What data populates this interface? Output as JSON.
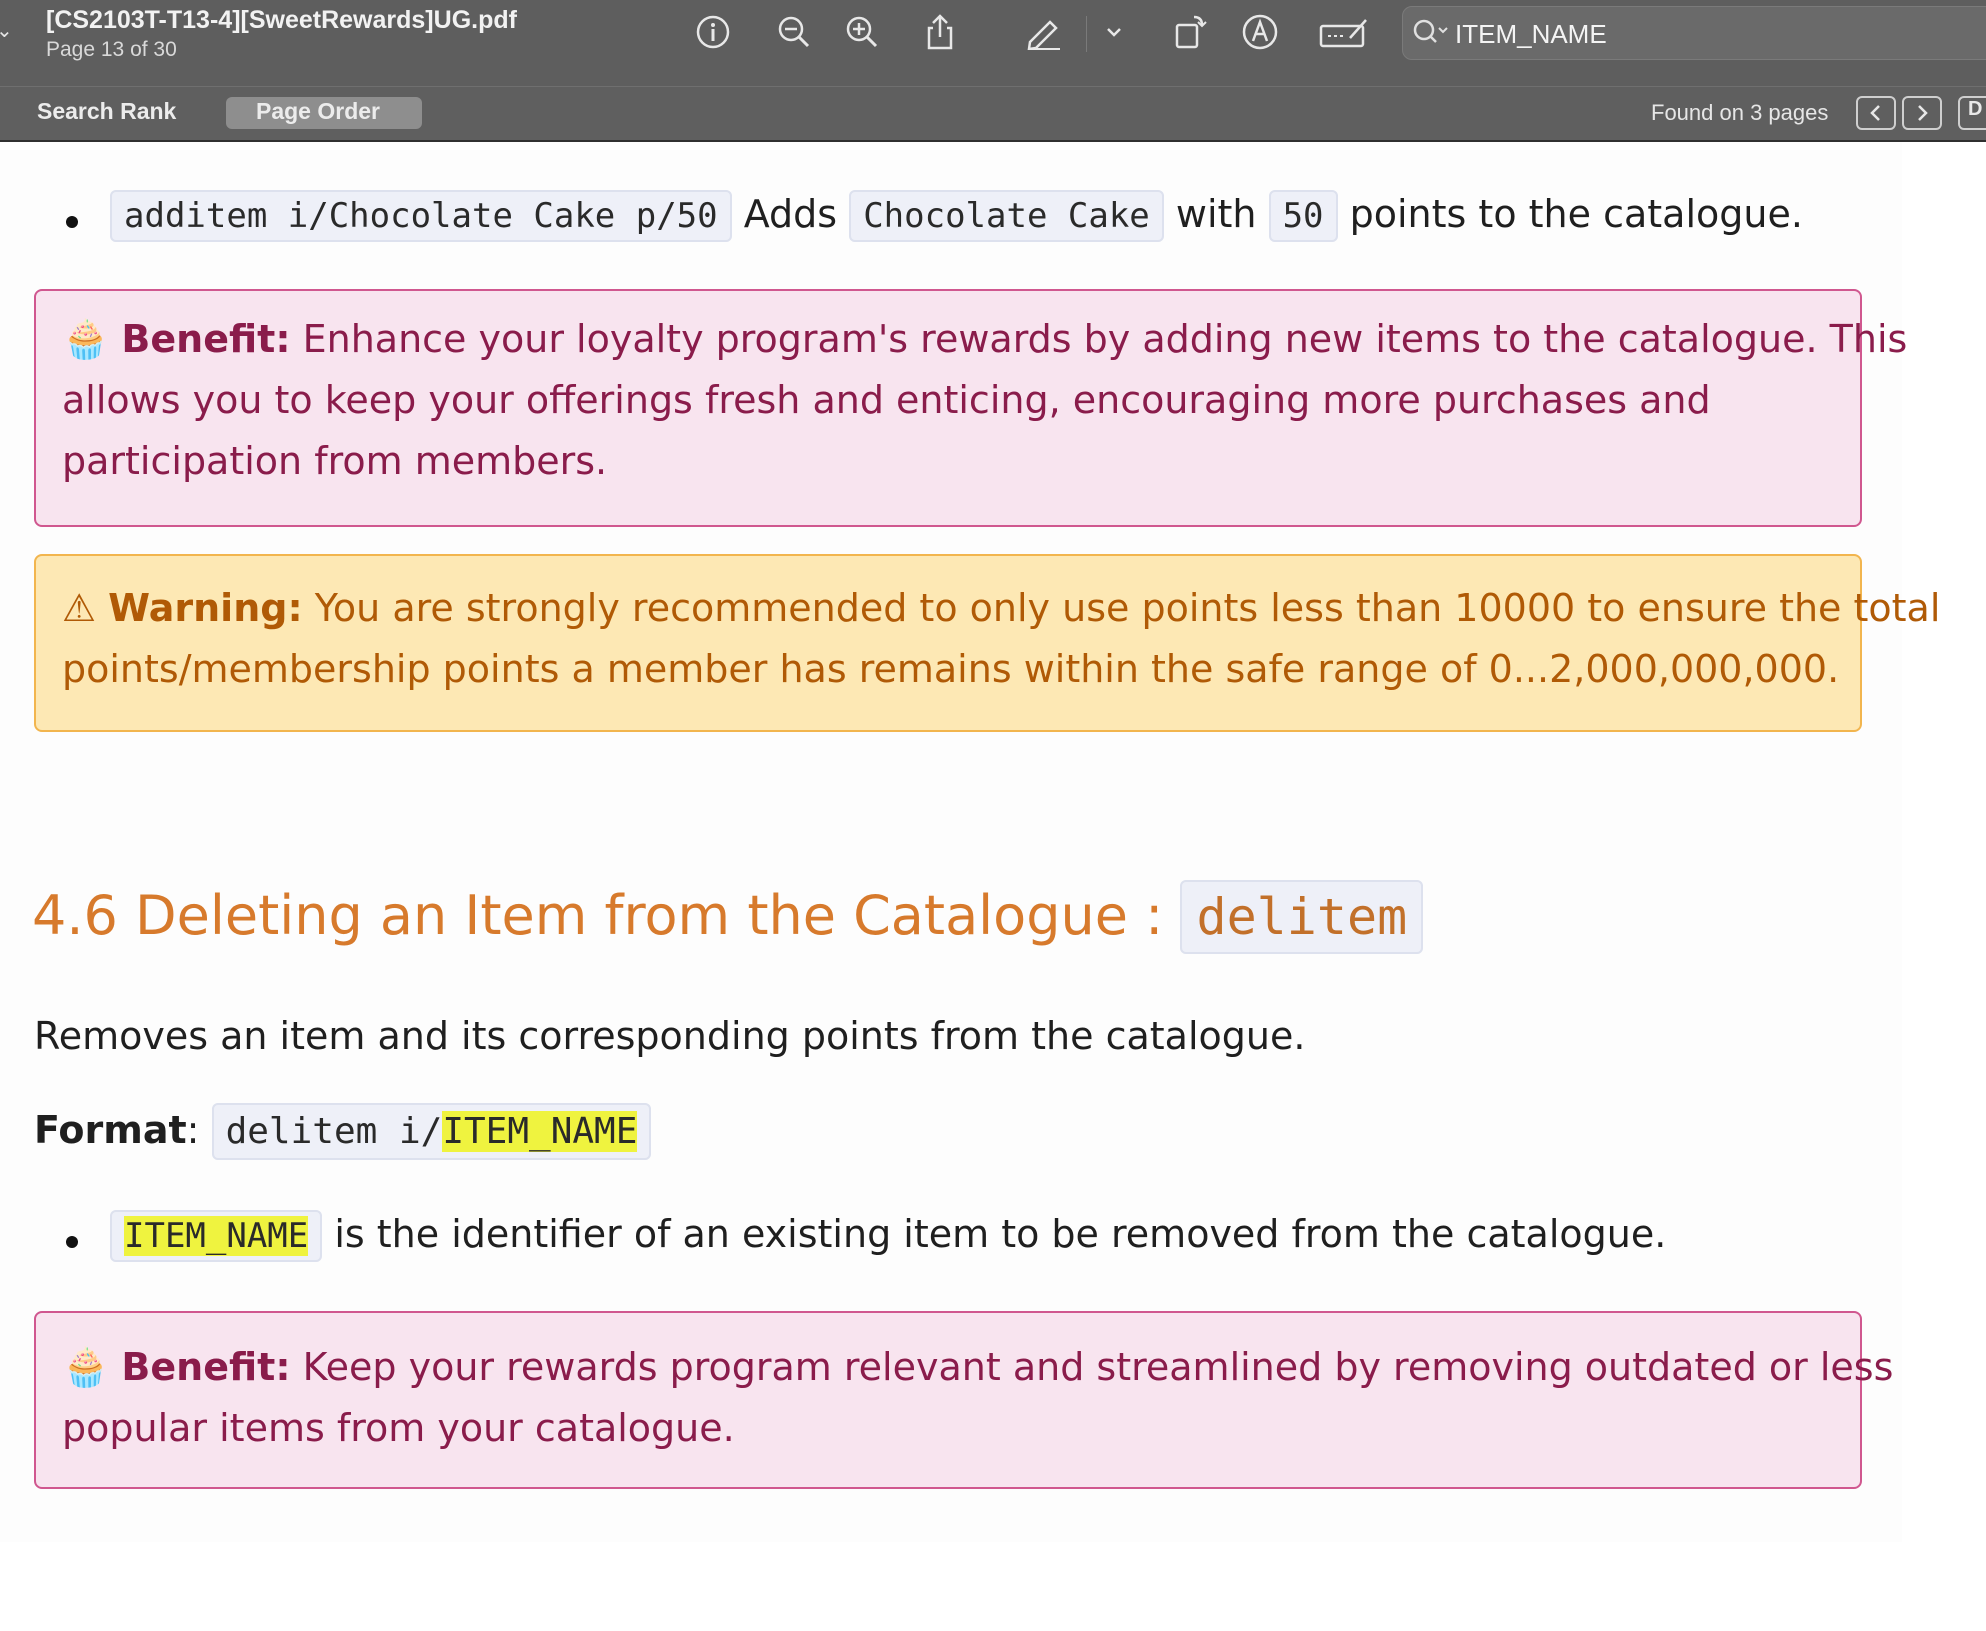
{
  "toolbar": {
    "title": "[CS2103T-T13-4][SweetRewards]UG.pdf",
    "page_indicator": "Page 13 of 30",
    "search_value": "ITEM_NAME",
    "icons": [
      "info-icon",
      "zoom-out-icon",
      "zoom-in-icon",
      "share-icon",
      "markup-pen-icon",
      "chevron-down-icon",
      "rotate-icon",
      "annotate-icon",
      "signature-icon",
      "search-icon"
    ]
  },
  "subbar": {
    "search_rank": "Search Rank",
    "page_order": "Page Order",
    "found": "Found on 3 pages",
    "extra_button": "D"
  },
  "content": {
    "example_bullet": {
      "code1": "additem i/Chocolate Cake p/50",
      "t1": "Adds",
      "code2": "Chocolate Cake",
      "t2": "with",
      "code3": "50",
      "t3": "points to the catalogue."
    },
    "benefit1": {
      "emoji": "🧁",
      "label": "Benefit:",
      "line1": "Enhance your loyalty program's rewards by adding new items to the catalogue. This",
      "line2": "allows you to keep your offerings fresh and enticing, encouraging more purchases and",
      "line3": "participation from members."
    },
    "warning": {
      "icon": "⚠",
      "label": "Warning:",
      "line1": "You are strongly recommended to only use points less than 10000 to ensure the total",
      "line2": "points/membership points a member has remains within the safe range of 0...2,000,000,000."
    },
    "heading": {
      "text": "4.6 Deleting an Item from the Catalogue :",
      "code": "delitem"
    },
    "description": "Removes an item and its corresponding points from the catalogue.",
    "format": {
      "label": "Format",
      "colon": ":",
      "code_prefix": "delitem i/",
      "code_highlight": "ITEM_NAME"
    },
    "param_bullet": {
      "code": "ITEM_NAME",
      "text": "is the identifier of an existing item to be removed from the catalogue."
    },
    "benefit2": {
      "emoji": "🧁",
      "label": "Benefit:",
      "line1": "Keep your rewards program relevant and streamlined by removing outdated or less",
      "line2": "popular items from your catalogue."
    },
    "colors": {
      "heading": "#d77a2c",
      "benefit_text": "#8a1c4b",
      "warning_text": "#b05a06",
      "highlight": "#eff33f"
    }
  }
}
